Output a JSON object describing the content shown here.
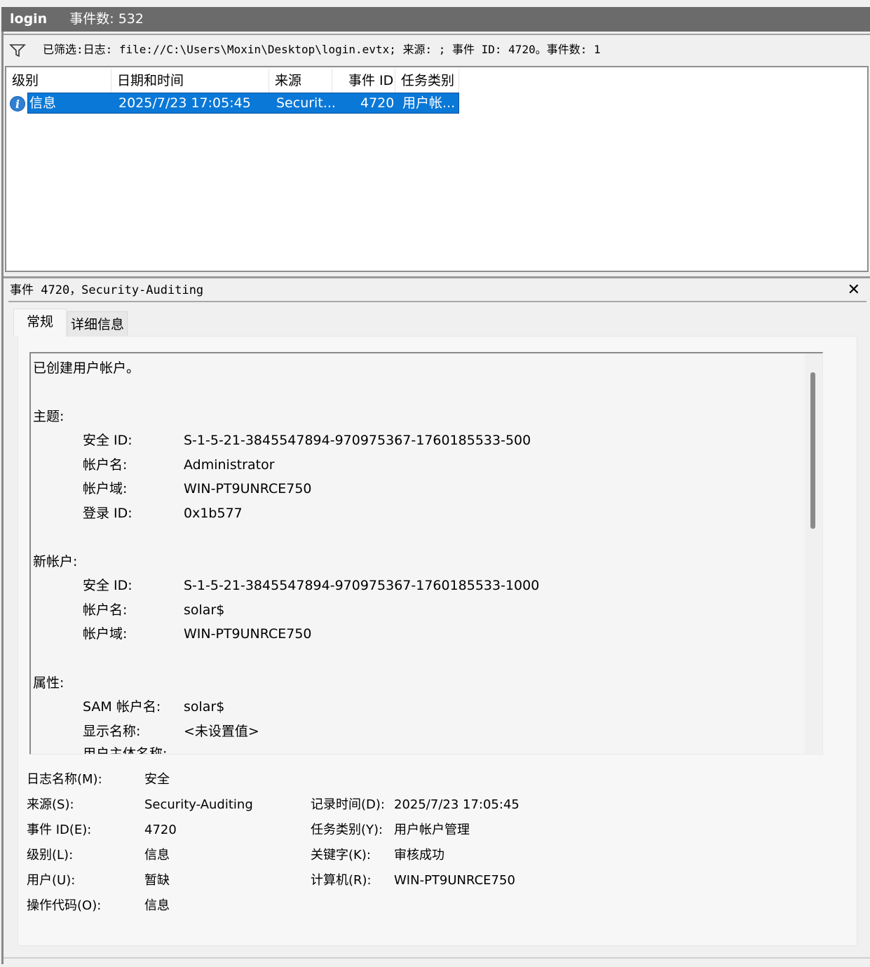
{
  "window": {
    "title": "login",
    "event_count": "事件数: 532"
  },
  "filter": {
    "text": "已筛选:日志: file://C:\\Users\\Moxin\\Desktop\\login.evtx; 来源: ; 事件 ID: 4720。事件数: 1"
  },
  "grid": {
    "columns": [
      "级别",
      "日期和时间",
      "来源",
      "事件 ID",
      "任务类别"
    ],
    "rows": [
      {
        "level": "信息",
        "datetime": "2025/7/23 17:05:45",
        "source": "Securit...",
        "event_id": "4720",
        "task": "用户帐..."
      }
    ]
  },
  "detail": {
    "title": "事件 4720，Security-Auditing",
    "tabs": [
      "常规",
      "详细信息"
    ],
    "text": {
      "summary": "已创建用户帐户。",
      "subject_header": "主题:",
      "subject": [
        {
          "label": "安全 ID:",
          "value": "S-1-5-21-3845547894-970975367-1760185533-500"
        },
        {
          "label": "帐户名:",
          "value": "Administrator"
        },
        {
          "label": "帐户域:",
          "value": "WIN-PT9UNRCE750"
        },
        {
          "label": "登录 ID:",
          "value": "0x1b577"
        }
      ],
      "new_account_header": "新帐户:",
      "new_account": [
        {
          "label": "安全 ID:",
          "value": "S-1-5-21-3845547894-970975367-1760185533-1000"
        },
        {
          "label": "帐户名:",
          "value": "solar$"
        },
        {
          "label": "帐户域:",
          "value": "WIN-PT9UNRCE750"
        }
      ],
      "attributes_header": "属性:",
      "attributes": [
        {
          "label": "SAM 帐户名:",
          "value": "solar$"
        },
        {
          "label": "显示名称:",
          "value": "<未设置值>"
        },
        {
          "label": "用户主体名称:",
          "value": ""
        }
      ]
    },
    "meta_left": [
      {
        "label": "日志名称(M):",
        "value": "安全"
      },
      {
        "label": "来源(S):",
        "value": "Security-Auditing"
      },
      {
        "label": "事件 ID(E):",
        "value": "4720"
      },
      {
        "label": "级别(L):",
        "value": "信息"
      },
      {
        "label": "用户(U):",
        "value": "暂缺"
      },
      {
        "label": "操作代码(O):",
        "value": "信息"
      }
    ],
    "meta_right": [
      {
        "label": "记录时间(D):",
        "value": "2025/7/23 17:05:45"
      },
      {
        "label": "任务类别(Y):",
        "value": "用户帐户管理"
      },
      {
        "label": "关键字(K):",
        "value": "审核成功"
      },
      {
        "label": "计算机(R):",
        "value": "WIN-PT9UNRCE750"
      }
    ]
  }
}
